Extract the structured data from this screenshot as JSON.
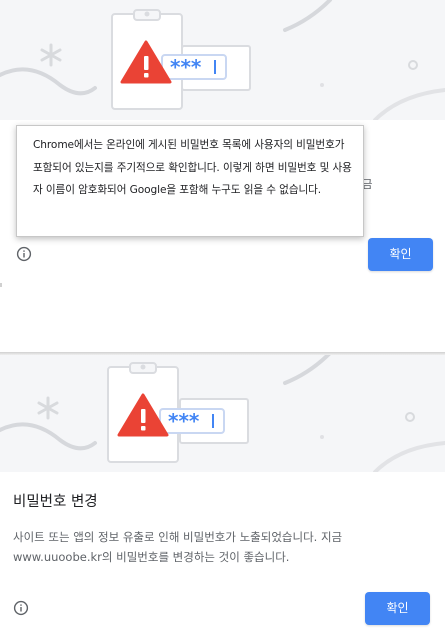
{
  "dialog_top": {
    "body_fragment": ". 지금",
    "confirm_label": "확인",
    "icon": "info-icon"
  },
  "tooltip": {
    "text": "Chrome에서는 온라인에 게시된 비밀번호 목록에 사용자의 비밀번호가 포함되어 있는지를 주기적으로 확인합니다. 이렇게 하면 비밀번호 및 사용자 이름이 암호화되어 Google을 포함해 누구도 읽을 수 없습니다."
  },
  "dialog_bottom": {
    "title": "비밀번호 변경",
    "body": "사이트 또는 앱의 정보 유출로 인해 비밀번호가 노출되었습니다. 지금 www.uuoobe.kr의 비밀번호를 변경하는 것이 좋습니다.",
    "confirm_label": "확인",
    "icon": "info-icon"
  },
  "illustration": {
    "password_mask": "***",
    "warning_mark": "!",
    "colors": {
      "warning": "#ea4335",
      "accent": "#4285f4",
      "hero_bg": "#f5f6f8"
    }
  }
}
